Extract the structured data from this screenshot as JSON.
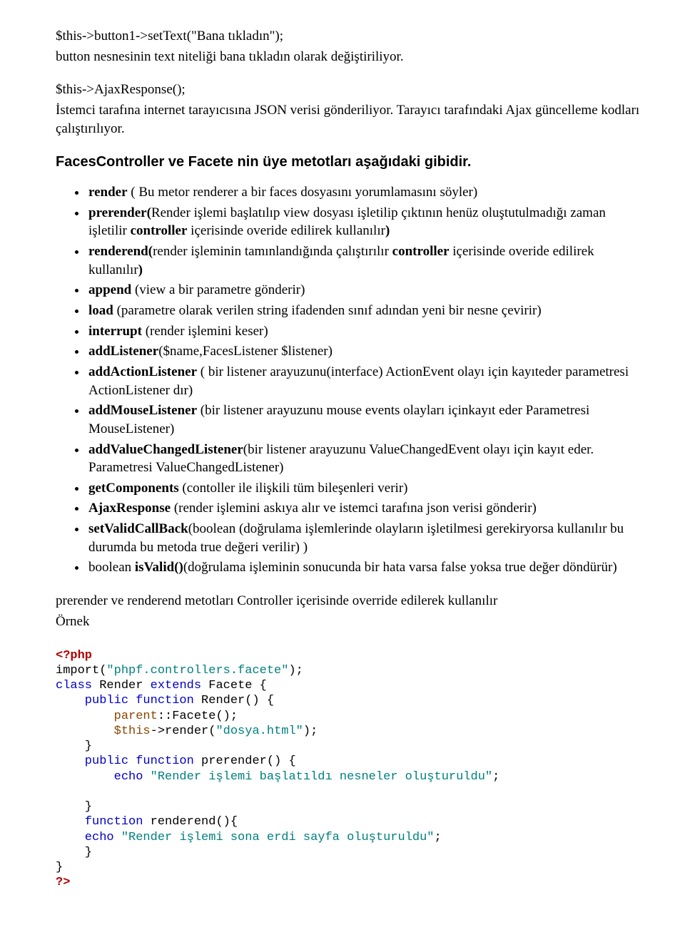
{
  "intro": {
    "l1": "$this->button1->setText(\"Bana tıkladın\");",
    "l2": "button nesnesinin text niteliği bana tıkladın olarak değiştiriliyor.",
    "l3": "$this->AjaxResponse();",
    "l4": "İstemci tarafına internet tarayıcısına JSON verisi gönderiliyor. Tarayıcı tarafındaki Ajax güncelleme kodları çalıştırılıyor."
  },
  "heading": "FacesController ve Facete nin üye metotları aşağıdaki gibidir.",
  "bullets": [
    {
      "b": "render",
      "t": " ( Bu metor renderer a bir faces dosyasını yorumlamasını söyler)"
    },
    {
      "b": "prerender(",
      "t": "Render işlemi başlatılıp view dosyası işletilip çıktının henüz oluştutulmadığı zaman işletilir ",
      "b2": "controller",
      "t2": " içerisinde overide edilirek kullanılır",
      "b3": ")"
    },
    {
      "b": "renderend(",
      "t": "render işleminin tamınlandığında çalıştırılır ",
      "b2": "controller",
      "t2": " içerisinde overide edilirek kullanılır",
      "b3": ")"
    },
    {
      "b": "append",
      "t": " (view a bir parametre gönderir)"
    },
    {
      "b": "load",
      "t": " (parametre olarak verilen string ifadenden sınıf adından yeni bir nesne çevirir)"
    },
    {
      "b": "interrupt",
      "t": " (render işlemini keser)"
    },
    {
      "b": "addListener",
      "t": "($name,FacesListener $listener)"
    },
    {
      "b": "addActionListener",
      "t": " ( bir listener arayuzunu(interface) ActionEvent olayı için kayıteder parametresi ActionListener dır)"
    },
    {
      "b": "addMouseListener",
      "t": " (bir listener arayuzunu mouse events olayları içinkayıt eder Parametresi MouseListener)"
    },
    {
      "b": "addValueChangedListener",
      "t": "(bir listener arayuzunu ValueChangedEvent olayı için kayıt eder. Parametresi ValueChangedListener)"
    },
    {
      "b": "getComponents",
      "t": " (contoller ile ilişkili tüm bileşenleri verir)"
    },
    {
      "b": "AjaxResponse",
      "t": " (render işlemini askıya alır ve istemci tarafına json verisi gönderir)"
    },
    {
      "b": "setValidCallBack",
      "t": "(boolean (doğrulama işlemlerinde olayların işletilmesi gerekiryorsa kullanılır bu durumda bu metoda true değeri verilir) )"
    },
    {
      "pre": "boolean ",
      "b": "isValid()",
      "t": "(doğrulama işleminin sonucunda bir hata varsa false yoksa true değer döndürür)"
    }
  ],
  "outro": {
    "l1": "prerender ve renderend metotları Controller içerisinde override edilerek kullanılır",
    "l2": "Örnek"
  },
  "code": {
    "l1a": "<?php",
    "l2a": "import(",
    "l2b": "\"phpf.controllers.facete\"",
    "l2c": ");",
    "l3a": "class",
    "l3b": " Render ",
    "l3c": "extends",
    "l3d": " Facete {",
    "l4a": "    public function",
    "l4b": " Render",
    "l4c": "() {",
    "l5a": "        parent",
    "l5b": "::",
    "l5c": "Facete",
    "l5d": "();",
    "l6a": "        $this",
    "l6b": "->",
    "l6c": "render",
    "l6d": "(",
    "l6e": "\"dosya.html\"",
    "l6f": ");",
    "l7a": "    }",
    "l8a": "    public function",
    "l8b": " prerender",
    "l8c": "() {",
    "l9a": "        echo ",
    "l9b": "\"Render işlemi başlatıldı nesneler oluşturuldu\"",
    "l9c": ";",
    "blank": "",
    "l10a": "    }",
    "l11a": "    function",
    "l11b": " renderend",
    "l11c": "(){",
    "l12a": "    echo ",
    "l12b": "\"Render işlemi sona erdi sayfa oluşturuldu\"",
    "l12c": ";",
    "l13a": "    }",
    "l14a": "}",
    "l15a": "?>"
  }
}
